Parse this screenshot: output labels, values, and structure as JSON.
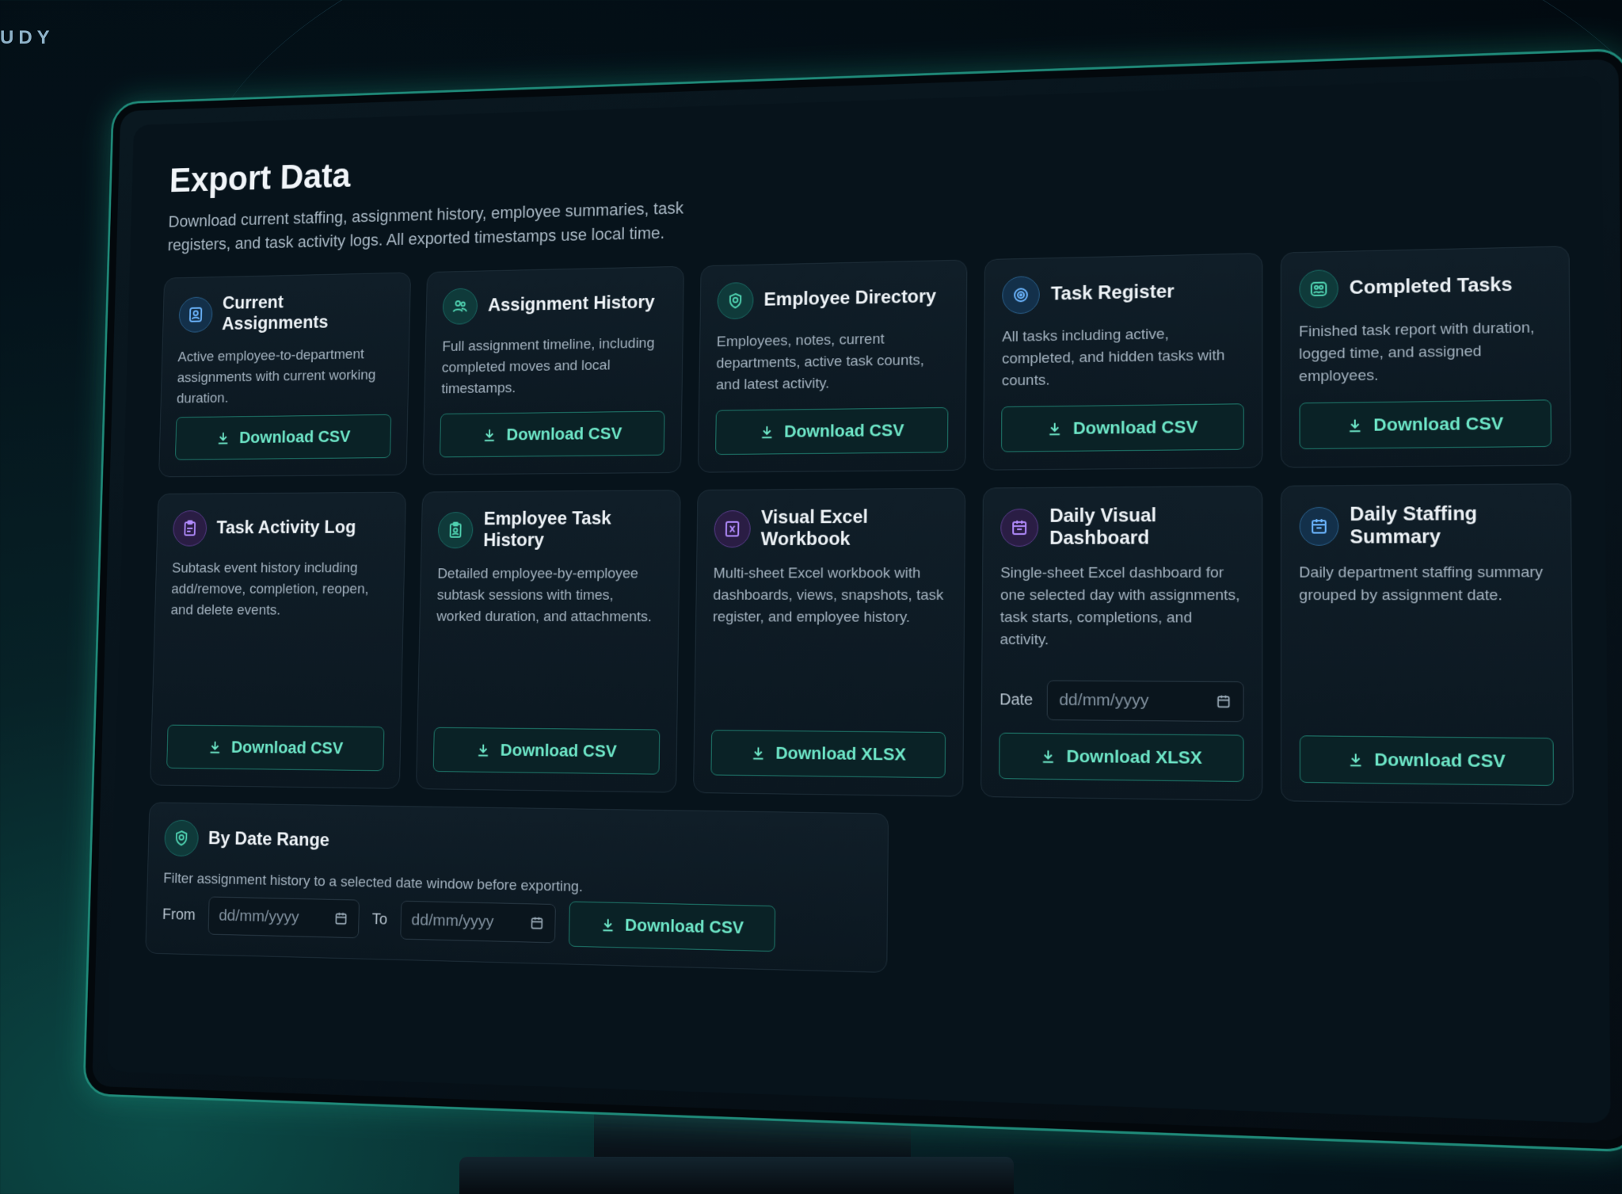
{
  "brand": "UDY",
  "page": {
    "title": "Export Data",
    "subtitle": "Download current staffing, assignment history, employee summaries, task registers, and task activity logs. All exported timestamps use local time."
  },
  "cards": [
    {
      "title": "Current Assignments",
      "desc": "Active employee-to-department assignments with current working duration.",
      "button": "Download CSV",
      "icon": "user-badge-icon",
      "accent": "blue"
    },
    {
      "title": "Assignment History",
      "desc": "Full assignment timeline, including completed moves and local timestamps.",
      "button": "Download CSV",
      "icon": "users-icon",
      "accent": "teal"
    },
    {
      "title": "Employee Directory",
      "desc": "Employees, notes, current departments, active task counts, and latest activity.",
      "button": "Download CSV",
      "icon": "id-badge-icon",
      "accent": "teal"
    },
    {
      "title": "Task Register",
      "desc": "All tasks including active, completed, and hidden tasks with counts.",
      "button": "Download CSV",
      "icon": "target-icon",
      "accent": "blue"
    },
    {
      "title": "Completed Tasks",
      "desc": "Finished task report with duration, logged time, and assigned employees.",
      "button": "Download CSV",
      "icon": "team-icon",
      "accent": "teal"
    },
    {
      "title": "Task Activity Log",
      "desc": "Subtask event history including add/remove, completion, reopen, and delete events.",
      "button": "Download CSV",
      "icon": "clipboard-icon",
      "accent": "purple"
    },
    {
      "title": "Employee Task History",
      "desc": "Detailed employee-by-employee subtask sessions with times, worked duration, and attachments.",
      "button": "Download CSV",
      "icon": "clipboard-user-icon",
      "accent": "teal"
    },
    {
      "title": "Visual Excel Workbook",
      "desc": "Multi-sheet Excel workbook with dashboards, views, snapshots, task register, and employee history.",
      "button": "Download XLSX",
      "icon": "excel-icon",
      "accent": "purple"
    },
    {
      "title": "Daily Visual Dashboard",
      "desc": "Single-sheet Excel dashboard for one selected day with assignments, task starts, completions, and activity.",
      "button": "Download XLSX",
      "icon": "calendar-icon",
      "accent": "purple",
      "date_label": "Date",
      "date_placeholder": "dd/mm/yyyy"
    },
    {
      "title": "Daily Staffing Summary",
      "desc": "Daily department staffing summary grouped by assignment date.",
      "button": "Download CSV",
      "icon": "calendar-icon",
      "accent": "blue"
    }
  ],
  "range": {
    "title": "By Date Range",
    "desc": "Filter assignment history to a selected date window before exporting.",
    "from_label": "From",
    "to_label": "To",
    "from_placeholder": "dd/mm/yyyy",
    "to_placeholder": "dd/mm/yyyy",
    "button": "Download CSV",
    "icon": "id-badge-icon"
  },
  "colors": {
    "accent": "#6ee7c8",
    "border_glow": "#1f8a79",
    "teal_icon": "#4fd1b0",
    "blue_icon": "#6cb6ff",
    "purple_icon": "#b38cff"
  }
}
